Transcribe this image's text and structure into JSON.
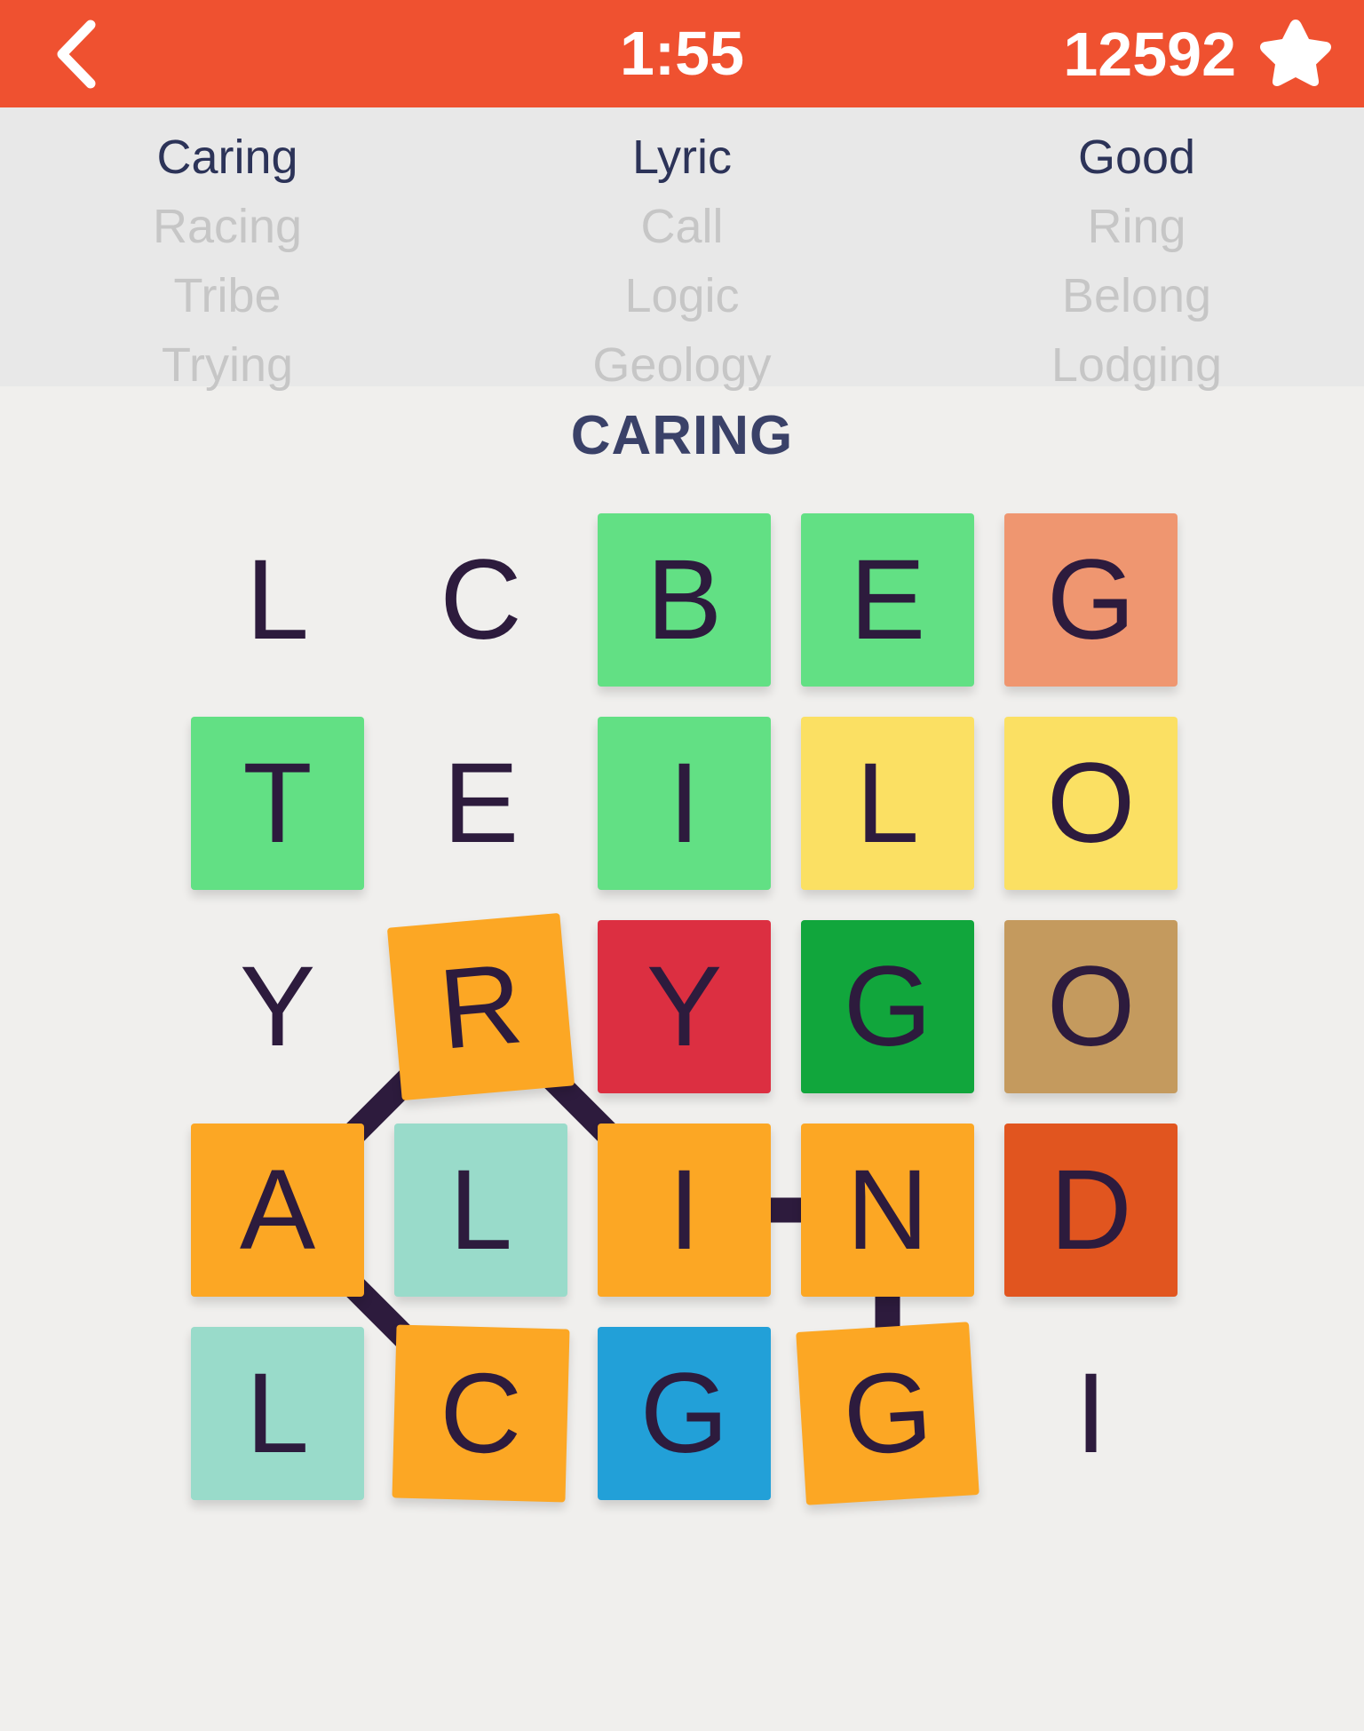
{
  "topbar": {
    "back_icon": "chevron-left-icon",
    "timer": "1:55",
    "score": "12592",
    "star_icon": "star-icon",
    "background_color": "#ef5130"
  },
  "wordlist": {
    "columns": [
      {
        "words": [
          {
            "text": "Caring",
            "found": true
          },
          {
            "text": "Racing",
            "found": false
          },
          {
            "text": "Tribe",
            "found": false
          },
          {
            "text": "Trying",
            "found": false
          }
        ]
      },
      {
        "words": [
          {
            "text": "Lyric",
            "found": true
          },
          {
            "text": "Call",
            "found": false
          },
          {
            "text": "Logic",
            "found": false
          },
          {
            "text": "Geology",
            "found": false
          }
        ]
      },
      {
        "words": [
          {
            "text": "Good",
            "found": true
          },
          {
            "text": "Ring",
            "found": false
          },
          {
            "text": "Belong",
            "found": false
          },
          {
            "text": "Lodging",
            "found": false
          }
        ]
      }
    ]
  },
  "current_word": "CARING",
  "grid": {
    "rows": 5,
    "cols": 5,
    "cell_size": 195,
    "gap": 34,
    "cells": [
      {
        "letter": "L",
        "tile": false,
        "color": null,
        "selected": false,
        "rotate": 0
      },
      {
        "letter": "C",
        "tile": false,
        "color": null,
        "selected": false,
        "rotate": 0
      },
      {
        "letter": "B",
        "tile": true,
        "color": "#62e084",
        "selected": false,
        "rotate": 0
      },
      {
        "letter": "E",
        "tile": true,
        "color": "#62e084",
        "selected": false,
        "rotate": 0
      },
      {
        "letter": "G",
        "tile": true,
        "color": "#ef9670",
        "selected": false,
        "rotate": 0
      },
      {
        "letter": "T",
        "tile": true,
        "color": "#62e084",
        "selected": false,
        "rotate": 0
      },
      {
        "letter": "E",
        "tile": false,
        "color": null,
        "selected": false,
        "rotate": 0
      },
      {
        "letter": "I",
        "tile": true,
        "color": "#62e084",
        "selected": false,
        "rotate": 0
      },
      {
        "letter": "L",
        "tile": true,
        "color": "#fbe063",
        "selected": false,
        "rotate": 0
      },
      {
        "letter": "O",
        "tile": true,
        "color": "#fbe063",
        "selected": false,
        "rotate": 0
      },
      {
        "letter": "Y",
        "tile": false,
        "color": null,
        "selected": false,
        "rotate": 0
      },
      {
        "letter": "R",
        "tile": true,
        "color": "#fca724",
        "selected": true,
        "rotate": -5
      },
      {
        "letter": "Y",
        "tile": true,
        "color": "#dc2f41",
        "selected": false,
        "rotate": 0
      },
      {
        "letter": "G",
        "tile": true,
        "color": "#11a63c",
        "selected": false,
        "rotate": 0
      },
      {
        "letter": "O",
        "tile": true,
        "color": "#c49a5e",
        "selected": false,
        "rotate": 0
      },
      {
        "letter": "A",
        "tile": true,
        "color": "#fca724",
        "selected": true,
        "rotate": 0
      },
      {
        "letter": "L",
        "tile": true,
        "color": "#99dbca",
        "selected": false,
        "rotate": 0
      },
      {
        "letter": "I",
        "tile": true,
        "color": "#fca724",
        "selected": true,
        "rotate": 0
      },
      {
        "letter": "N",
        "tile": true,
        "color": "#fca724",
        "selected": true,
        "rotate": 0
      },
      {
        "letter": "D",
        "tile": true,
        "color": "#e1551f",
        "selected": false,
        "rotate": 0
      },
      {
        "letter": "L",
        "tile": true,
        "color": "#99dbca",
        "selected": false,
        "rotate": 0
      },
      {
        "letter": "C",
        "tile": true,
        "color": "#fca724",
        "selected": true,
        "rotate": 1.5
      },
      {
        "letter": "G",
        "tile": true,
        "color": "#22a0d8",
        "selected": false,
        "rotate": 0
      },
      {
        "letter": "G",
        "tile": true,
        "color": "#fca724",
        "selected": true,
        "rotate": -3.5
      },
      {
        "letter": "I",
        "tile": false,
        "color": null,
        "selected": false,
        "rotate": 0
      }
    ],
    "connectors": [
      {
        "from": [
          2,
          1
        ],
        "to": [
          3,
          0
        ]
      },
      {
        "from": [
          2,
          1
        ],
        "to": [
          3,
          2
        ]
      },
      {
        "from": [
          3,
          0
        ],
        "to": [
          4,
          1
        ]
      },
      {
        "from": [
          3,
          2
        ],
        "to": [
          3,
          3
        ]
      },
      {
        "from": [
          3,
          3
        ],
        "to": [
          4,
          3
        ]
      }
    ],
    "connector_color": "#2d1b3d",
    "letter_color": "#2d1b3d",
    "selected_color": "#fca724"
  },
  "colors": {
    "page_background": "#f0efed",
    "wordlist_background": "#e8e8e8",
    "accent": "#ef5130",
    "text_dark": "#2c3358",
    "text_muted": "#c6c6c6"
  }
}
